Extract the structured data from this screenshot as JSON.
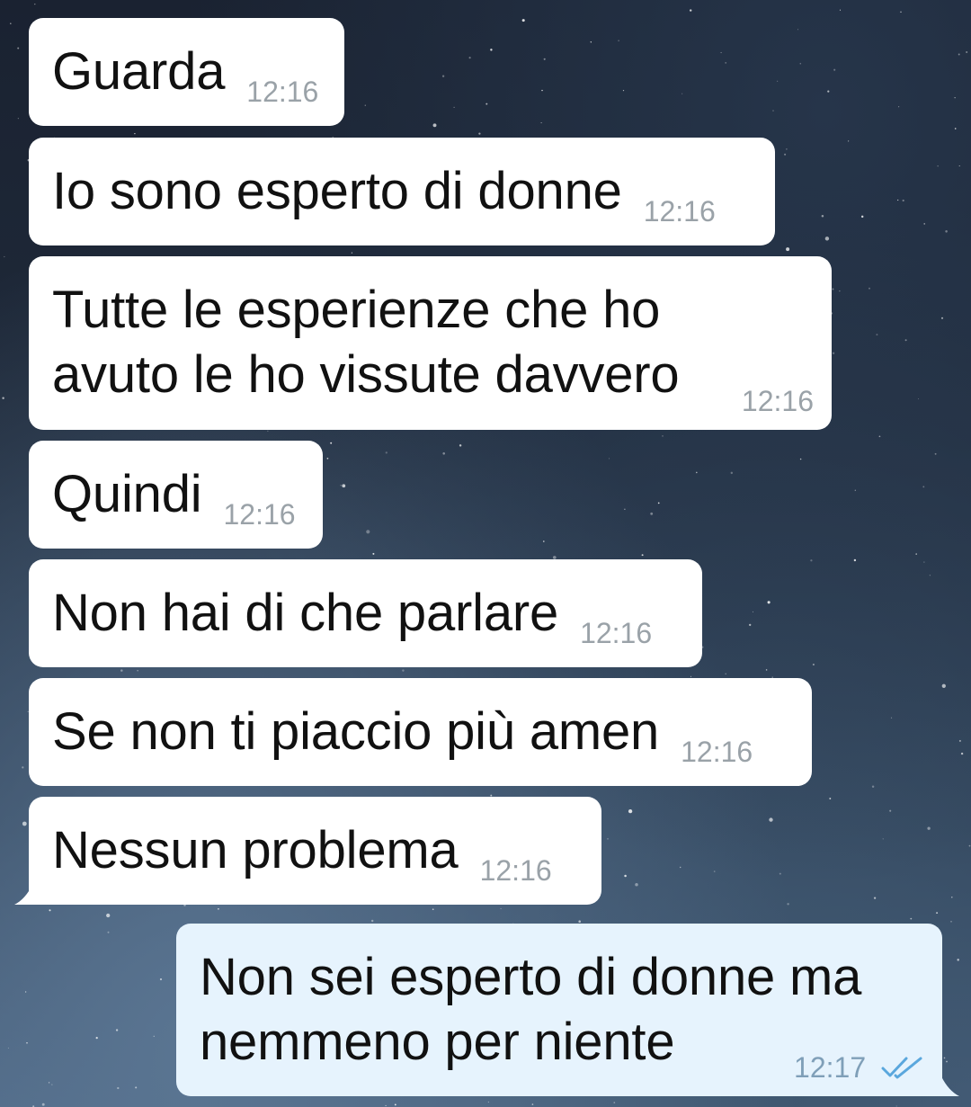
{
  "colors": {
    "incoming_bubble": "#ffffff",
    "outgoing_bubble": "#e6f3fd",
    "timestamp": "#9aa2a8",
    "read_check": "#5aa7dd"
  },
  "messages": [
    {
      "direction": "in",
      "text": "Guarda",
      "time": "12:16"
    },
    {
      "direction": "in",
      "text": "Io sono esperto di donne",
      "time": "12:16"
    },
    {
      "direction": "in",
      "text": "Tutte le esperienze che ho\navuto le ho vissute davvero",
      "time": "12:16"
    },
    {
      "direction": "in",
      "text": "Quindi",
      "time": "12:16"
    },
    {
      "direction": "in",
      "text": "Non hai di che parlare",
      "time": "12:16"
    },
    {
      "direction": "in",
      "text": "Se non ti piaccio più amen",
      "time": "12:16"
    },
    {
      "direction": "in",
      "text": "Nessun problema",
      "time": "12:16"
    },
    {
      "direction": "out",
      "text": "Non sei esperto di donne ma\nnemmeno per niente",
      "time": "12:17",
      "status_icon": "double-check-read-icon"
    }
  ]
}
